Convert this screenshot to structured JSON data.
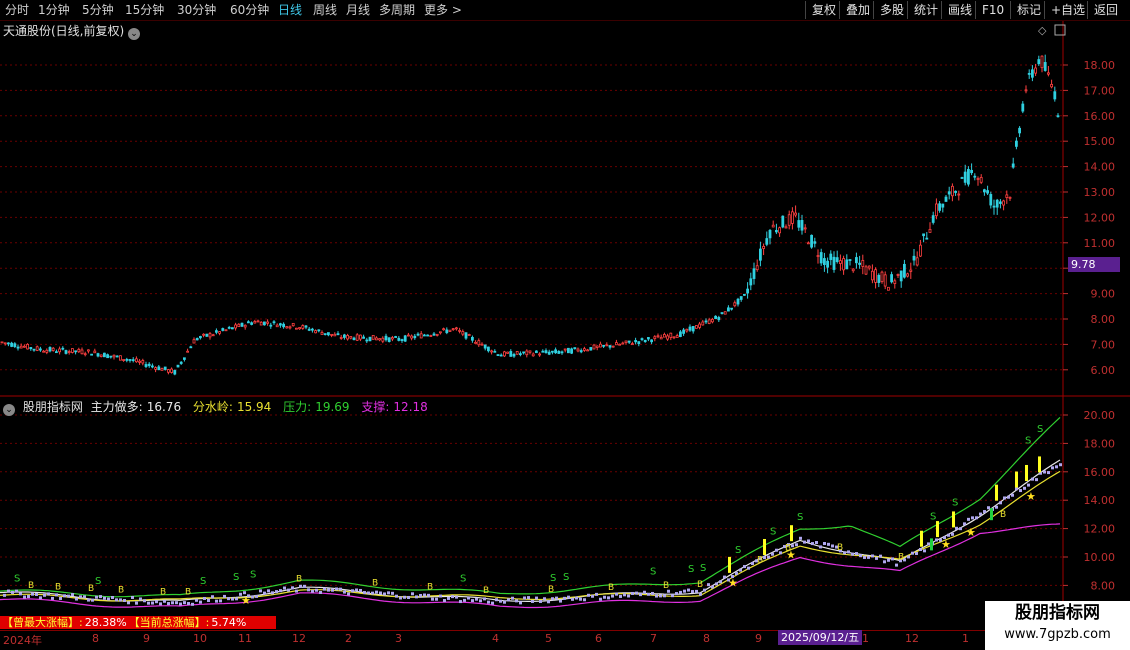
{
  "toolbar": {
    "timeframes": [
      "分时",
      "1分钟",
      "5分钟",
      "15分钟",
      "30分钟",
      "60分钟",
      "日线",
      "周线",
      "月线",
      "多周期",
      "更多 >"
    ],
    "active": "日线",
    "buttons": [
      "复权",
      "叠加",
      "多股",
      "统计",
      "画线",
      "F10",
      "标记",
      "+自选",
      "返回"
    ]
  },
  "chart_title": "天通股份(日线,前复权)",
  "price_axis": {
    "ticks": [
      "18.00",
      "17.00",
      "16.00",
      "15.00",
      "14.00",
      "13.00",
      "12.00",
      "11.00",
      "10.00",
      "9.00",
      "8.00",
      "7.00",
      "6.00"
    ],
    "current_price": "9.78"
  },
  "indicator": {
    "name": "股朋指标网",
    "items": [
      {
        "label": "主力做多:",
        "value": "16.76",
        "color": "#e8e8e8"
      },
      {
        "label": "分水岭:",
        "value": "15.94",
        "color": "#e8e030"
      },
      {
        "label": "压力:",
        "value": "19.69",
        "color": "#30d030"
      },
      {
        "label": "支撑:",
        "value": "12.18",
        "color": "#e030e0"
      }
    ],
    "axis_ticks": [
      "20.00",
      "18.00",
      "16.00",
      "14.00",
      "12.00",
      "10.00",
      "8.00"
    ]
  },
  "stats": {
    "max_label": "【曾最大涨幅】:",
    "max_value": "28.38%",
    "cur_label": "【当前总涨幅】:",
    "cur_value": "5.74%"
  },
  "x_axis": {
    "labels": [
      "2024年",
      "8",
      "9",
      "10",
      "11",
      "12",
      "2",
      "3",
      "4",
      "5",
      "6",
      "7",
      "8",
      "9",
      "1",
      "12",
      "1"
    ],
    "cursor_date": "2025/09/12/五"
  },
  "watermark": {
    "title": "股朋指标网",
    "url": "www.7gpzb.com"
  },
  "chart_data": {
    "type": "candlestick",
    "title": "天通股份(日线,前复权)",
    "y_range": [
      5.5,
      19.2
    ],
    "trend_points": [
      {
        "x": 0,
        "y": 7.1
      },
      {
        "x": 40,
        "y": 6.8
      },
      {
        "x": 90,
        "y": 6.7
      },
      {
        "x": 130,
        "y": 6.4
      },
      {
        "x": 175,
        "y": 5.9
      },
      {
        "x": 195,
        "y": 7.2
      },
      {
        "x": 255,
        "y": 7.9
      },
      {
        "x": 300,
        "y": 7.7
      },
      {
        "x": 340,
        "y": 7.3
      },
      {
        "x": 400,
        "y": 7.2
      },
      {
        "x": 455,
        "y": 7.6
      },
      {
        "x": 500,
        "y": 6.6
      },
      {
        "x": 560,
        "y": 6.7
      },
      {
        "x": 620,
        "y": 7.0
      },
      {
        "x": 680,
        "y": 7.4
      },
      {
        "x": 720,
        "y": 8.1
      },
      {
        "x": 745,
        "y": 8.9
      },
      {
        "x": 770,
        "y": 11.5
      },
      {
        "x": 795,
        "y": 12.0
      },
      {
        "x": 825,
        "y": 10.3
      },
      {
        "x": 860,
        "y": 10.1
      },
      {
        "x": 890,
        "y": 9.4
      },
      {
        "x": 915,
        "y": 10.2
      },
      {
        "x": 935,
        "y": 12.2
      },
      {
        "x": 975,
        "y": 13.9
      },
      {
        "x": 995,
        "y": 12.4
      },
      {
        "x": 1010,
        "y": 13.0
      },
      {
        "x": 1025,
        "y": 17.0
      },
      {
        "x": 1040,
        "y": 18.3
      },
      {
        "x": 1055,
        "y": 16.9
      },
      {
        "x": 1062,
        "y": 15.3
      }
    ],
    "indicator_series": [
      {
        "name": "主力做多",
        "color": "#e8e8e8",
        "points": [
          {
            "x": 0,
            "y": 7.5
          },
          {
            "x": 180,
            "y": 6.8
          },
          {
            "x": 300,
            "y": 7.8
          },
          {
            "x": 500,
            "y": 6.9
          },
          {
            "x": 700,
            "y": 7.6
          },
          {
            "x": 800,
            "y": 11.2
          },
          {
            "x": 900,
            "y": 9.6
          },
          {
            "x": 980,
            "y": 13.0
          },
          {
            "x": 1060,
            "y": 16.7
          }
        ]
      },
      {
        "name": "分水岭",
        "color": "#e8e030",
        "points": [
          {
            "x": 0,
            "y": 7.3
          },
          {
            "x": 180,
            "y": 6.9
          },
          {
            "x": 300,
            "y": 7.6
          },
          {
            "x": 500,
            "y": 7.1
          },
          {
            "x": 700,
            "y": 7.4
          },
          {
            "x": 800,
            "y": 10.8
          },
          {
            "x": 900,
            "y": 9.7
          },
          {
            "x": 980,
            "y": 12.4
          },
          {
            "x": 1060,
            "y": 15.9
          }
        ]
      },
      {
        "name": "压力",
        "color": "#30d030",
        "points": [
          {
            "x": 0,
            "y": 7.6
          },
          {
            "x": 180,
            "y": 7.2
          },
          {
            "x": 300,
            "y": 8.3
          },
          {
            "x": 500,
            "y": 7.4
          },
          {
            "x": 700,
            "y": 8.3
          },
          {
            "x": 800,
            "y": 12.0
          },
          {
            "x": 850,
            "y": 12.3
          },
          {
            "x": 900,
            "y": 10.6
          },
          {
            "x": 980,
            "y": 14.2
          },
          {
            "x": 1060,
            "y": 19.7
          }
        ]
      },
      {
        "name": "支撑",
        "color": "#e030e0",
        "points": [
          {
            "x": 0,
            "y": 7.0
          },
          {
            "x": 180,
            "y": 6.4
          },
          {
            "x": 300,
            "y": 7.4
          },
          {
            "x": 500,
            "y": 6.5
          },
          {
            "x": 700,
            "y": 7.0
          },
          {
            "x": 800,
            "y": 10.0
          },
          {
            "x": 900,
            "y": 8.9
          },
          {
            "x": 980,
            "y": 11.8
          },
          {
            "x": 1060,
            "y": 12.2
          }
        ]
      }
    ]
  }
}
